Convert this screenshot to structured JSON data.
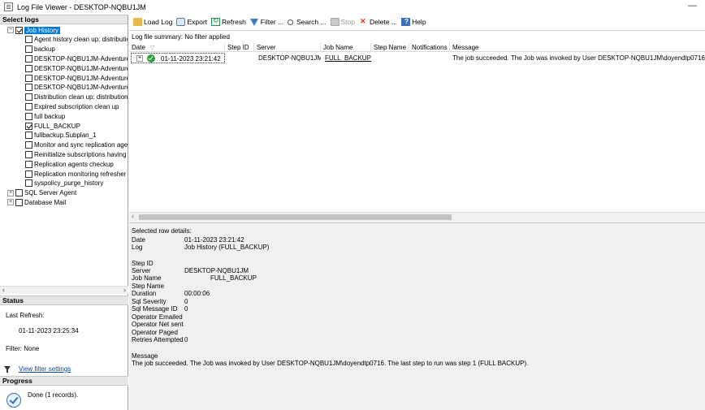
{
  "window": {
    "title": "Log File Viewer - DESKTOP-NQBU1JM",
    "minimize": "—"
  },
  "left": {
    "select_logs_title": "Select logs",
    "tree": [
      {
        "label": "Job History",
        "level": 0,
        "expander": "⊟",
        "checked": true,
        "selected": true
      },
      {
        "label": "Agent history clean up: distribution",
        "level": 1,
        "checked": false
      },
      {
        "label": "backup",
        "level": 1,
        "checked": false
      },
      {
        "label": "DESKTOP-NQBU1JM-AdventureWo",
        "level": 1,
        "checked": false
      },
      {
        "label": "DESKTOP-NQBU1JM-AdventureWo",
        "level": 1,
        "checked": false
      },
      {
        "label": "DESKTOP-NQBU1JM-AdventureWo",
        "level": 1,
        "checked": false
      },
      {
        "label": "DESKTOP-NQBU1JM-AdventureWo",
        "level": 1,
        "checked": false
      },
      {
        "label": "Distribution clean up: distribution",
        "level": 1,
        "checked": false
      },
      {
        "label": "Expired subscription clean up",
        "level": 1,
        "checked": false
      },
      {
        "label": "full backup",
        "level": 1,
        "checked": false
      },
      {
        "label": "FULL_BACKUP",
        "level": 1,
        "checked": true
      },
      {
        "label": "fullbackup.Subplan_1",
        "level": 1,
        "checked": false
      },
      {
        "label": "Monitor and sync replication agent jo",
        "level": 1,
        "checked": false
      },
      {
        "label": "Reinitialize subscriptions having data",
        "level": 1,
        "checked": false
      },
      {
        "label": "Replication agents checkup",
        "level": 1,
        "checked": false
      },
      {
        "label": "Replication monitoring refresher for d",
        "level": 1,
        "checked": false
      },
      {
        "label": "syspolicy_purge_history",
        "level": 1,
        "checked": false
      },
      {
        "label": "SQL Server Agent",
        "level": 0,
        "expander": "⊞",
        "checked": false
      },
      {
        "label": "Database Mail",
        "level": 0,
        "expander": "⊞",
        "checked": false
      }
    ],
    "scroll_left": "‹",
    "scroll_right": "›",
    "status_title": "Status",
    "last_refresh_label": "Last Refresh:",
    "last_refresh_value": "01-11-2023 23:25:34",
    "filter_text": "Filter: None",
    "view_filter_link": "View filter settings",
    "progress_title": "Progress",
    "progress_text": "Done (1 records)."
  },
  "toolbar": {
    "load_log": "Load Log",
    "export": "Export",
    "refresh": "Refresh",
    "filter": "Filter ...",
    "search": "Search ...",
    "stop": "Stop",
    "delete": "Delete ...",
    "help": "Help"
  },
  "grid": {
    "summary": "Log file summary: No filter applied",
    "sort_arrow": "▽",
    "columns": {
      "date": "Date",
      "step_id": "Step ID",
      "server": "Server",
      "job_name": "Job Name",
      "step_name": "Step Name",
      "notifications": "Notifications",
      "message": "Message"
    },
    "row": {
      "expander": "+",
      "date": "01-11-2023 23:21:42",
      "server": "DESKTOP-NQBU1JM",
      "job_name": "FULL_BACKUP",
      "message": "The job succeeded.  The Job was invoked by User DESKTOP-NQBU1JM\\doyendtp0716.  The l"
    },
    "scroll_left": "‹"
  },
  "details": {
    "title": "Selected row details:",
    "date_label": "Date",
    "date_value": "01-11-2023 23:21:42",
    "log_label": "Log",
    "log_value": "Job History (FULL_BACKUP)",
    "step_id_label": "Step ID",
    "server_label": "Server",
    "server_value": "DESKTOP-NQBU1JM",
    "job_name_label": "Job Name",
    "job_name_value": "FULL_BACKUP",
    "step_name_label": "Step Name",
    "duration_label": "Duration",
    "duration_value": "00:00:06",
    "sql_severity_label": "Sql Severity",
    "sql_severity_value": "0",
    "sql_message_id_label": "Sql Message ID",
    "sql_message_id_value": "0",
    "operator_emailed_label": "Operator Emailed",
    "operator_net_sent_label": "Operator Net sent",
    "operator_paged_label": "Operator Paged",
    "retries_label": "Retries Attempted",
    "retries_value": "0",
    "message_label": "Message",
    "message_value": "The job succeeded.  The Job was invoked by User DESKTOP-NQBU1JM\\doyendtp0716.  The last step to run was step 1 (FULL BACKUP)."
  }
}
